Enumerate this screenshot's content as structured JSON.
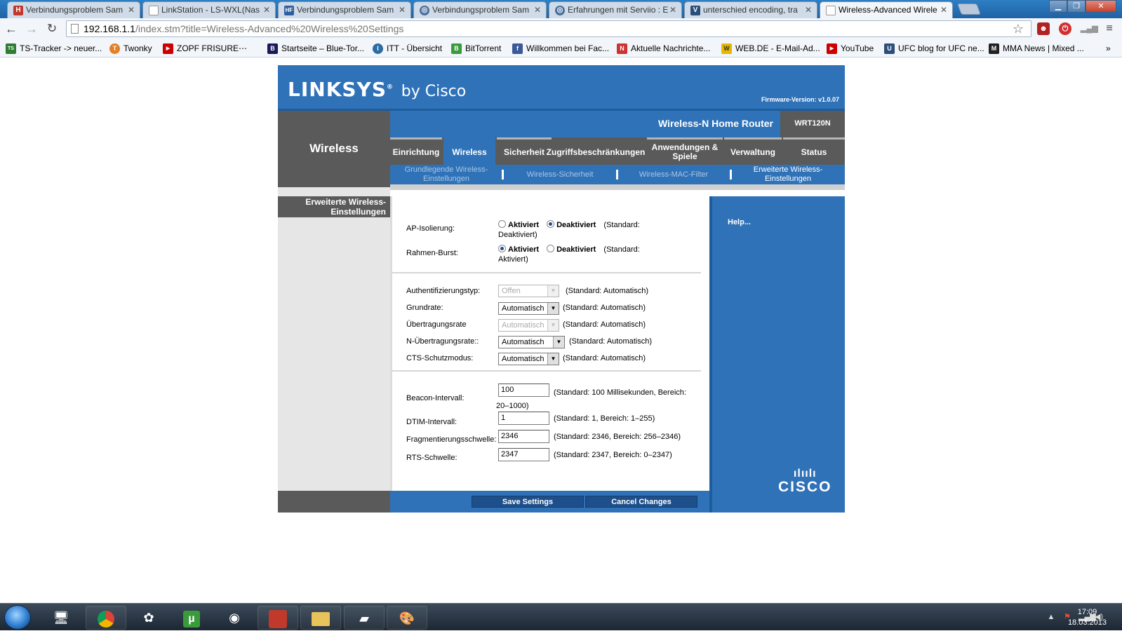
{
  "browser": {
    "tabs": [
      {
        "title": "Verbindungsproblem Sam",
        "icon": "h-favicon",
        "color": "#c0392b",
        "glyph": "H"
      },
      {
        "title": "LinkStation - LS-WXL(Nas",
        "icon": "page-favicon",
        "color": "#888888",
        "glyph": ""
      },
      {
        "title": "Verbindungsproblem Sam",
        "icon": "hf-favicon",
        "color": "#2d5fa0",
        "glyph": "HF"
      },
      {
        "title": "Verbindungsproblem Sam",
        "icon": "globe-favicon",
        "color": "#4a6f9c",
        "glyph": "◎"
      },
      {
        "title": "Erfahrungen mit Serviio : E",
        "icon": "globe-favicon",
        "color": "#4a6f9c",
        "glyph": "◎"
      },
      {
        "title": "unterschied encoding, tra",
        "icon": "v-favicon",
        "color": "#2a4d7a",
        "glyph": "V"
      },
      {
        "title": "Wireless-Advanced Wirele",
        "icon": "page-favicon",
        "color": "#888888",
        "glyph": ""
      }
    ],
    "url_host": "192.168.1.1",
    "url_path": "/index.stm?title=Wireless-Advanced%20Wireless%20Settings",
    "bookmarks": [
      {
        "label": "TS-Tracker -> neuer...",
        "icon": "ts-icon",
        "color": "#2e7d32",
        "glyph": "TS"
      },
      {
        "label": "Twonky",
        "icon": "twonky-icon",
        "color": "#e67e22",
        "glyph": "T"
      },
      {
        "label": "ZOPF FRISURE⋯",
        "icon": "youtube-icon",
        "color": "#cc0000",
        "glyph": "▶"
      },
      {
        "label": "Startseite – Blue-Tor...",
        "icon": "bluetor-icon",
        "color": "#1a1a5a",
        "glyph": "B"
      },
      {
        "label": "ITT - Übersicht",
        "icon": "itt-icon",
        "color": "#2b6ca3",
        "glyph": "I"
      },
      {
        "label": "BitTorrent",
        "icon": "bittorrent-icon",
        "color": "#3a9b3a",
        "glyph": "B"
      },
      {
        "label": "Willkommen bei Fac...",
        "icon": "facebook-icon",
        "color": "#3b5998",
        "glyph": "f"
      },
      {
        "label": "Aktuelle Nachrichte...",
        "icon": "news-icon",
        "color": "#cc3333",
        "glyph": "N"
      },
      {
        "label": "WEB.DE - E-Mail-Ad...",
        "icon": "webde-icon",
        "color": "#e6b800",
        "glyph": "W"
      },
      {
        "label": "YouTube",
        "icon": "youtube-icon",
        "color": "#cc0000",
        "glyph": "▶"
      },
      {
        "label": "UFC blog for UFC ne...",
        "icon": "ufc-icon",
        "color": "#2b4f7a",
        "glyph": "U"
      },
      {
        "label": "MMA News | Mixed ...",
        "icon": "mma-icon",
        "color": "#222222",
        "glyph": "M"
      }
    ],
    "more_bookmarks": "»"
  },
  "router": {
    "brand": "LINKSYS",
    "brand_suffix": "by Cisco",
    "firmware": "Firmware-Version: v1.0.07",
    "product": "Wireless-N Home Router",
    "model": "WRT120N",
    "section": "Wireless",
    "main_tabs": [
      "Einrichtung",
      "Wireless",
      "Sicherheit",
      "Zugriffsbeschränkungen",
      "Anwendungen & Spiele",
      "Verwaltung",
      "Status"
    ],
    "active_tab": "Wireless",
    "sub_tabs": [
      "Grundlegende Wireless-Einstellungen",
      "Wireless-Sicherheit",
      "Wireless-MAC-Filter",
      "Erweiterte Wireless-Einstellungen"
    ],
    "page_section": "Erweiterte Wireless-Einstellungen",
    "help": "Help...",
    "fields": {
      "ap_isolation": {
        "label": "AP-Isolierung:",
        "opt_on": "Aktiviert",
        "opt_off": "Deaktiviert",
        "selected": "Deaktiviert",
        "hint": "(Standard: Deaktiviert)"
      },
      "frame_burst": {
        "label": "Rahmen-Burst:",
        "opt_on": "Aktiviert",
        "opt_off": "Deaktiviert",
        "selected": "Aktiviert",
        "hint": "(Standard: Aktiviert)"
      },
      "auth_type": {
        "label": "Authentifizierungstyp:",
        "value": "Offen",
        "hint": "(Standard: Automatisch)",
        "disabled": true
      },
      "basic_rate": {
        "label": "Grundrate:",
        "value": "Automatisch",
        "hint": "(Standard: Automatisch)"
      },
      "tx_rate": {
        "label": "Übertragungsrate",
        "value": "Automatisch",
        "hint": "(Standard: Automatisch)",
        "disabled": true
      },
      "n_tx_rate": {
        "label": "N-Übertragungsrate::",
        "value": "Automatisch",
        "hint": "(Standard: Automatisch)"
      },
      "cts_mode": {
        "label": "CTS-Schutzmodus:",
        "value": "Automatisch",
        "hint": "(Standard: Automatisch)"
      },
      "beacon": {
        "label": "Beacon-Intervall:",
        "value": "100",
        "hint": "(Standard: 100 Millisekunden, Bereich: 20–1000)"
      },
      "dtim": {
        "label": "DTIM-Intervall:",
        "value": "1",
        "hint": "(Standard: 1, Bereich: 1–255)"
      },
      "frag": {
        "label": "Fragmentierungsschwelle:",
        "value": "2346",
        "hint": "(Standard: 2346, Bereich: 256–2346)"
      },
      "rts": {
        "label": "RTS-Schwelle:",
        "value": "2347",
        "hint": "(Standard: 2347, Bereich: 0–2347)"
      }
    },
    "save_label": "Save Settings",
    "cancel_label": "Cancel Changes",
    "cisco_bars": "ılıılı",
    "cisco_word": "CISCO"
  },
  "taskbar": {
    "time": "17:09",
    "date": "18.03.2013"
  }
}
